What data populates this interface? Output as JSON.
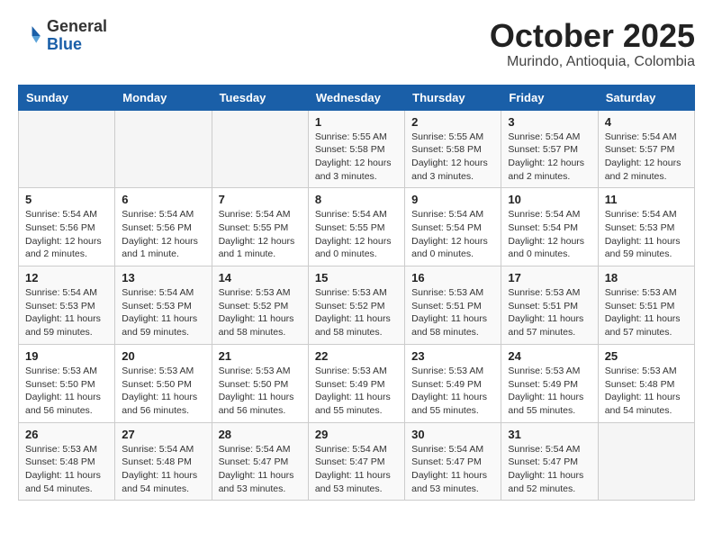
{
  "header": {
    "logo_general": "General",
    "logo_blue": "Blue",
    "month": "October 2025",
    "location": "Murindo, Antioquia, Colombia"
  },
  "weekdays": [
    "Sunday",
    "Monday",
    "Tuesday",
    "Wednesday",
    "Thursday",
    "Friday",
    "Saturday"
  ],
  "weeks": [
    [
      {
        "day": "",
        "info": ""
      },
      {
        "day": "",
        "info": ""
      },
      {
        "day": "",
        "info": ""
      },
      {
        "day": "1",
        "info": "Sunrise: 5:55 AM\nSunset: 5:58 PM\nDaylight: 12 hours\nand 3 minutes."
      },
      {
        "day": "2",
        "info": "Sunrise: 5:55 AM\nSunset: 5:58 PM\nDaylight: 12 hours\nand 3 minutes."
      },
      {
        "day": "3",
        "info": "Sunrise: 5:54 AM\nSunset: 5:57 PM\nDaylight: 12 hours\nand 2 minutes."
      },
      {
        "day": "4",
        "info": "Sunrise: 5:54 AM\nSunset: 5:57 PM\nDaylight: 12 hours\nand 2 minutes."
      }
    ],
    [
      {
        "day": "5",
        "info": "Sunrise: 5:54 AM\nSunset: 5:56 PM\nDaylight: 12 hours\nand 2 minutes."
      },
      {
        "day": "6",
        "info": "Sunrise: 5:54 AM\nSunset: 5:56 PM\nDaylight: 12 hours\nand 1 minute."
      },
      {
        "day": "7",
        "info": "Sunrise: 5:54 AM\nSunset: 5:55 PM\nDaylight: 12 hours\nand 1 minute."
      },
      {
        "day": "8",
        "info": "Sunrise: 5:54 AM\nSunset: 5:55 PM\nDaylight: 12 hours\nand 0 minutes."
      },
      {
        "day": "9",
        "info": "Sunrise: 5:54 AM\nSunset: 5:54 PM\nDaylight: 12 hours\nand 0 minutes."
      },
      {
        "day": "10",
        "info": "Sunrise: 5:54 AM\nSunset: 5:54 PM\nDaylight: 12 hours\nand 0 minutes."
      },
      {
        "day": "11",
        "info": "Sunrise: 5:54 AM\nSunset: 5:53 PM\nDaylight: 11 hours\nand 59 minutes."
      }
    ],
    [
      {
        "day": "12",
        "info": "Sunrise: 5:54 AM\nSunset: 5:53 PM\nDaylight: 11 hours\nand 59 minutes."
      },
      {
        "day": "13",
        "info": "Sunrise: 5:54 AM\nSunset: 5:53 PM\nDaylight: 11 hours\nand 59 minutes."
      },
      {
        "day": "14",
        "info": "Sunrise: 5:53 AM\nSunset: 5:52 PM\nDaylight: 11 hours\nand 58 minutes."
      },
      {
        "day": "15",
        "info": "Sunrise: 5:53 AM\nSunset: 5:52 PM\nDaylight: 11 hours\nand 58 minutes."
      },
      {
        "day": "16",
        "info": "Sunrise: 5:53 AM\nSunset: 5:51 PM\nDaylight: 11 hours\nand 58 minutes."
      },
      {
        "day": "17",
        "info": "Sunrise: 5:53 AM\nSunset: 5:51 PM\nDaylight: 11 hours\nand 57 minutes."
      },
      {
        "day": "18",
        "info": "Sunrise: 5:53 AM\nSunset: 5:51 PM\nDaylight: 11 hours\nand 57 minutes."
      }
    ],
    [
      {
        "day": "19",
        "info": "Sunrise: 5:53 AM\nSunset: 5:50 PM\nDaylight: 11 hours\nand 56 minutes."
      },
      {
        "day": "20",
        "info": "Sunrise: 5:53 AM\nSunset: 5:50 PM\nDaylight: 11 hours\nand 56 minutes."
      },
      {
        "day": "21",
        "info": "Sunrise: 5:53 AM\nSunset: 5:50 PM\nDaylight: 11 hours\nand 56 minutes."
      },
      {
        "day": "22",
        "info": "Sunrise: 5:53 AM\nSunset: 5:49 PM\nDaylight: 11 hours\nand 55 minutes."
      },
      {
        "day": "23",
        "info": "Sunrise: 5:53 AM\nSunset: 5:49 PM\nDaylight: 11 hours\nand 55 minutes."
      },
      {
        "day": "24",
        "info": "Sunrise: 5:53 AM\nSunset: 5:49 PM\nDaylight: 11 hours\nand 55 minutes."
      },
      {
        "day": "25",
        "info": "Sunrise: 5:53 AM\nSunset: 5:48 PM\nDaylight: 11 hours\nand 54 minutes."
      }
    ],
    [
      {
        "day": "26",
        "info": "Sunrise: 5:53 AM\nSunset: 5:48 PM\nDaylight: 11 hours\nand 54 minutes."
      },
      {
        "day": "27",
        "info": "Sunrise: 5:54 AM\nSunset: 5:48 PM\nDaylight: 11 hours\nand 54 minutes."
      },
      {
        "day": "28",
        "info": "Sunrise: 5:54 AM\nSunset: 5:47 PM\nDaylight: 11 hours\nand 53 minutes."
      },
      {
        "day": "29",
        "info": "Sunrise: 5:54 AM\nSunset: 5:47 PM\nDaylight: 11 hours\nand 53 minutes."
      },
      {
        "day": "30",
        "info": "Sunrise: 5:54 AM\nSunset: 5:47 PM\nDaylight: 11 hours\nand 53 minutes."
      },
      {
        "day": "31",
        "info": "Sunrise: 5:54 AM\nSunset: 5:47 PM\nDaylight: 11 hours\nand 52 minutes."
      },
      {
        "day": "",
        "info": ""
      }
    ]
  ]
}
